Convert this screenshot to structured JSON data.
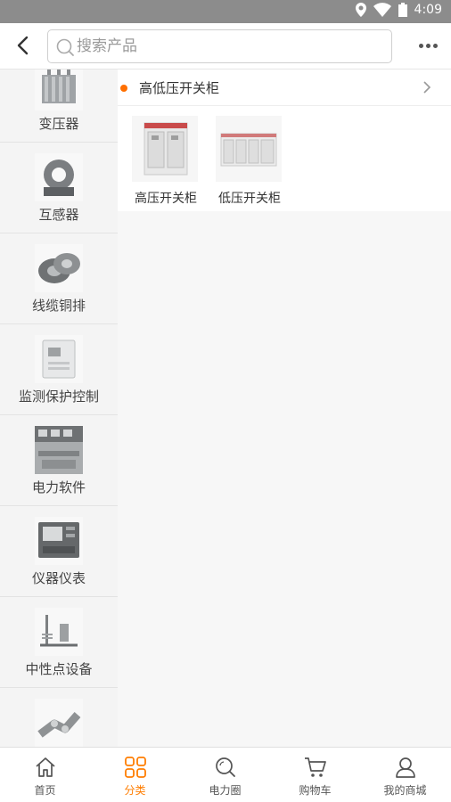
{
  "status_bar": {
    "time": "4:09"
  },
  "header": {
    "search_placeholder": "搜索产品"
  },
  "sidebar": {
    "items": [
      {
        "label": "变压器"
      },
      {
        "label": "互感器"
      },
      {
        "label": "线缆铜排"
      },
      {
        "label": "监测保护控制"
      },
      {
        "label": "电力软件"
      },
      {
        "label": "仪器仪表"
      },
      {
        "label": "中性点设备"
      },
      {
        "label": ""
      }
    ]
  },
  "content": {
    "section_title": "高低压开关柜",
    "products": [
      {
        "label": "高压开关柜"
      },
      {
        "label": "低压开关柜"
      }
    ]
  },
  "tabbar": {
    "active_color": "#ff7d00",
    "tabs": [
      {
        "label": "首页",
        "icon": "home-icon"
      },
      {
        "label": "分类",
        "icon": "category-grid-icon"
      },
      {
        "label": "电力圈",
        "icon": "search-circle-icon"
      },
      {
        "label": "购物车",
        "icon": "cart-icon"
      },
      {
        "label": "我的商城",
        "icon": "user-icon"
      }
    ]
  }
}
